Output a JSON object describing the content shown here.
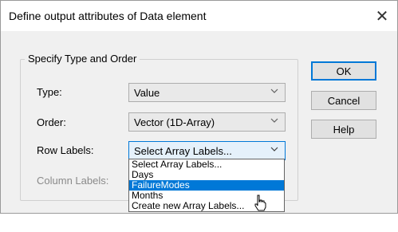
{
  "dialog": {
    "title": "Define output attributes of Data element",
    "close_symbol": "✕",
    "group_title": "Specify Type and Order"
  },
  "fields": {
    "type_label": "Type:",
    "type_value": "Value",
    "order_label": "Order:",
    "order_value": "Vector (1D-Array)",
    "row_labels_label": "Row Labels:",
    "row_labels_value": "Select Array Labels...",
    "column_labels_label": "Column Labels:"
  },
  "buttons": {
    "ok": "OK",
    "cancel": "Cancel",
    "help": "Help"
  },
  "dropdown": {
    "items": [
      "Select Array Labels...",
      "Days",
      "FailureModes",
      "Months",
      "Create new Array Labels..."
    ],
    "highlighted": "FailureModes"
  },
  "colors": {
    "accent": "#0078d7",
    "dialog_bg": "#f0f0f0"
  }
}
